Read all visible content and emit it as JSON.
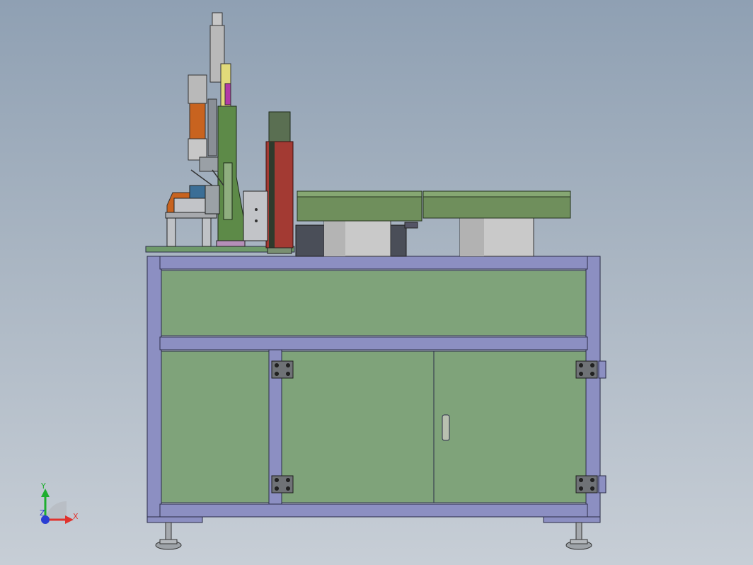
{
  "viewport": {
    "name": "cad-model-front-view",
    "background_top": "#8fa0b3",
    "background_bottom": "#c7ced6"
  },
  "colors": {
    "frame": "#8c8fc2",
    "frame_dark": "#5b5f93",
    "panel": "#7fa37a",
    "panel_dark": "#4f6c4c",
    "bowl": "#6f8f5c",
    "cylinder": "#c4c4c4",
    "accent_red": "#a33a33",
    "accent_orange": "#c8631f",
    "foot": "#9ea3a8"
  },
  "triad": {
    "y_label": "Y",
    "x_label": "X",
    "z_label": "Z",
    "y_color": "#1fae2f",
    "x_color": "#e0332d",
    "z_color": "#2a3ed3"
  }
}
